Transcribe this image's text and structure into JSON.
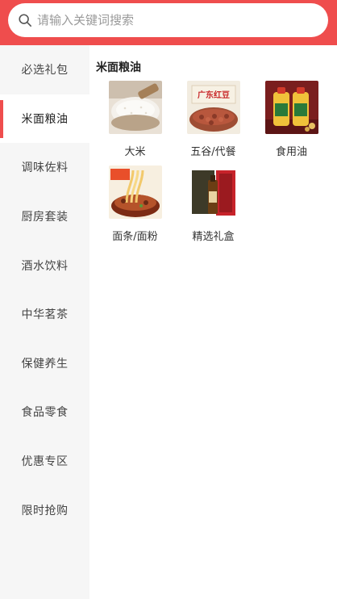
{
  "search": {
    "placeholder": "请输入关键词搜索"
  },
  "sidebar": {
    "items": [
      {
        "label": "必选礼包",
        "active": false
      },
      {
        "label": "米面粮油",
        "active": true
      },
      {
        "label": "调味佐料",
        "active": false
      },
      {
        "label": "厨房套装",
        "active": false
      },
      {
        "label": "酒水饮料",
        "active": false
      },
      {
        "label": "中华茗茶",
        "active": false
      },
      {
        "label": "保健养生",
        "active": false
      },
      {
        "label": "食品零食",
        "active": false
      },
      {
        "label": "优惠专区",
        "active": false
      },
      {
        "label": "限时抢购",
        "active": false
      }
    ]
  },
  "main": {
    "section_title": "米面粮油",
    "categories": [
      {
        "label": "大米",
        "icon": "rice-image"
      },
      {
        "label": "五谷/代餐",
        "icon": "red-beans-image",
        "image_text": "广东红豆"
      },
      {
        "label": "食用油",
        "icon": "cooking-oil-image"
      },
      {
        "label": "面条/面粉",
        "icon": "noodles-image"
      },
      {
        "label": "精选礼盒",
        "icon": "gift-box-image"
      }
    ]
  },
  "colors": {
    "accent": "#ef4d4d",
    "sidebar_bg": "#f6f6f6"
  }
}
